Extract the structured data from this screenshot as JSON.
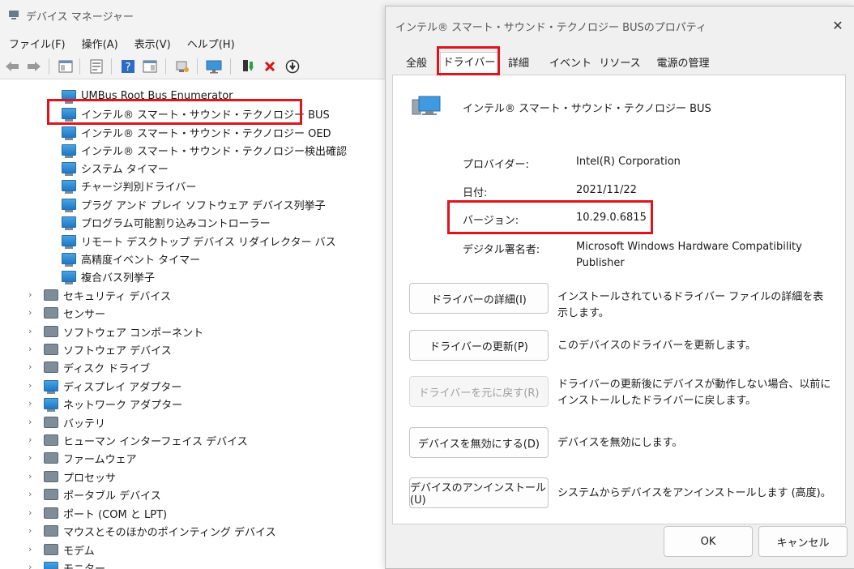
{
  "device_manager": {
    "title": "デバイス マネージャー",
    "menus": [
      "ファイル(F)",
      "操作(A)",
      "表示(V)",
      "ヘルプ(H)"
    ],
    "toolbar_icons": [
      "back-arrow-icon",
      "forward-arrow-icon",
      "properties-pane-icon",
      "document-icon",
      "help-icon",
      "view-icon",
      "scan-icon",
      "monitor-icon",
      "update-driver-icon",
      "uninstall-icon",
      "download-icon"
    ],
    "child_devices": [
      "UMBus Root Bus Enumerator",
      "インテル® スマート・サウンド・テクノロジー BUS",
      "インテル® スマート・サウンド・テクノロジー OED",
      "インテル® スマート・サウンド・テクノロジー検出確認",
      "システム タイマー",
      "チャージ判別ドライバー",
      "プラグ アンド プレイ ソフトウェア デバイス列挙子",
      "プログラム可能割り込みコントローラー",
      "リモート デスクトップ デバイス リダイレクター バス",
      "高精度イベント タイマー",
      "複合バス列挙子"
    ],
    "categories": [
      "セキュリティ デバイス",
      "センサー",
      "ソフトウェア コンポーネント",
      "ソフトウェア デバイス",
      "ディスク ドライブ",
      "ディスプレイ アダプター",
      "ネットワーク アダプター",
      "バッテリ",
      "ヒューマン インターフェイス デバイス",
      "ファームウェア",
      "プロセッサ",
      "ポータブル デバイス",
      "ポート (COM と LPT)",
      "マウスとそのほかのポインティング デバイス",
      "モデム",
      "モニター"
    ],
    "collapse_glyph": "›"
  },
  "dialog": {
    "title": "インテル® スマート・サウンド・テクノロジー BUSのプロパティ",
    "close_glyph": "✕",
    "tabs": [
      "全般",
      "ドライバー",
      "詳細",
      "イベント",
      "リソース",
      "電源の管理"
    ],
    "active_tab": "ドライバー",
    "device_name": "インテル® スマート・サウンド・テクノロジー BUS",
    "properties": {
      "provider_label": "プロバイダー:",
      "provider_value": "Intel(R) Corporation",
      "date_label": "日付:",
      "date_value": "2021/11/22",
      "version_label": "バージョン:",
      "version_value": "10.29.0.6815",
      "signer_label": "デジタル署名者:",
      "signer_value": "Microsoft Windows Hardware Compatibility Publisher"
    },
    "actions": [
      {
        "label": "ドライバーの詳細(I)",
        "desc": "インストールされているドライバー ファイルの詳細を表示します。",
        "enabled": true
      },
      {
        "label": "ドライバーの更新(P)",
        "desc": "このデバイスのドライバーを更新します。",
        "enabled": true
      },
      {
        "label": "ドライバーを元に戻す(R)",
        "desc": "ドライバーの更新後にデバイスが動作しない場合、以前にインストールしたドライバーに戻します。",
        "enabled": false
      },
      {
        "label": "デバイスを無効にする(D)",
        "desc": "デバイスを無効にします。",
        "enabled": true
      },
      {
        "label": "デバイスのアンインストール(U)",
        "desc": "システムからデバイスをアンインストールします (高度)。",
        "enabled": true
      }
    ],
    "ok_label": "OK",
    "cancel_label": "キャンセル"
  },
  "highlight_color": "#e0141e"
}
